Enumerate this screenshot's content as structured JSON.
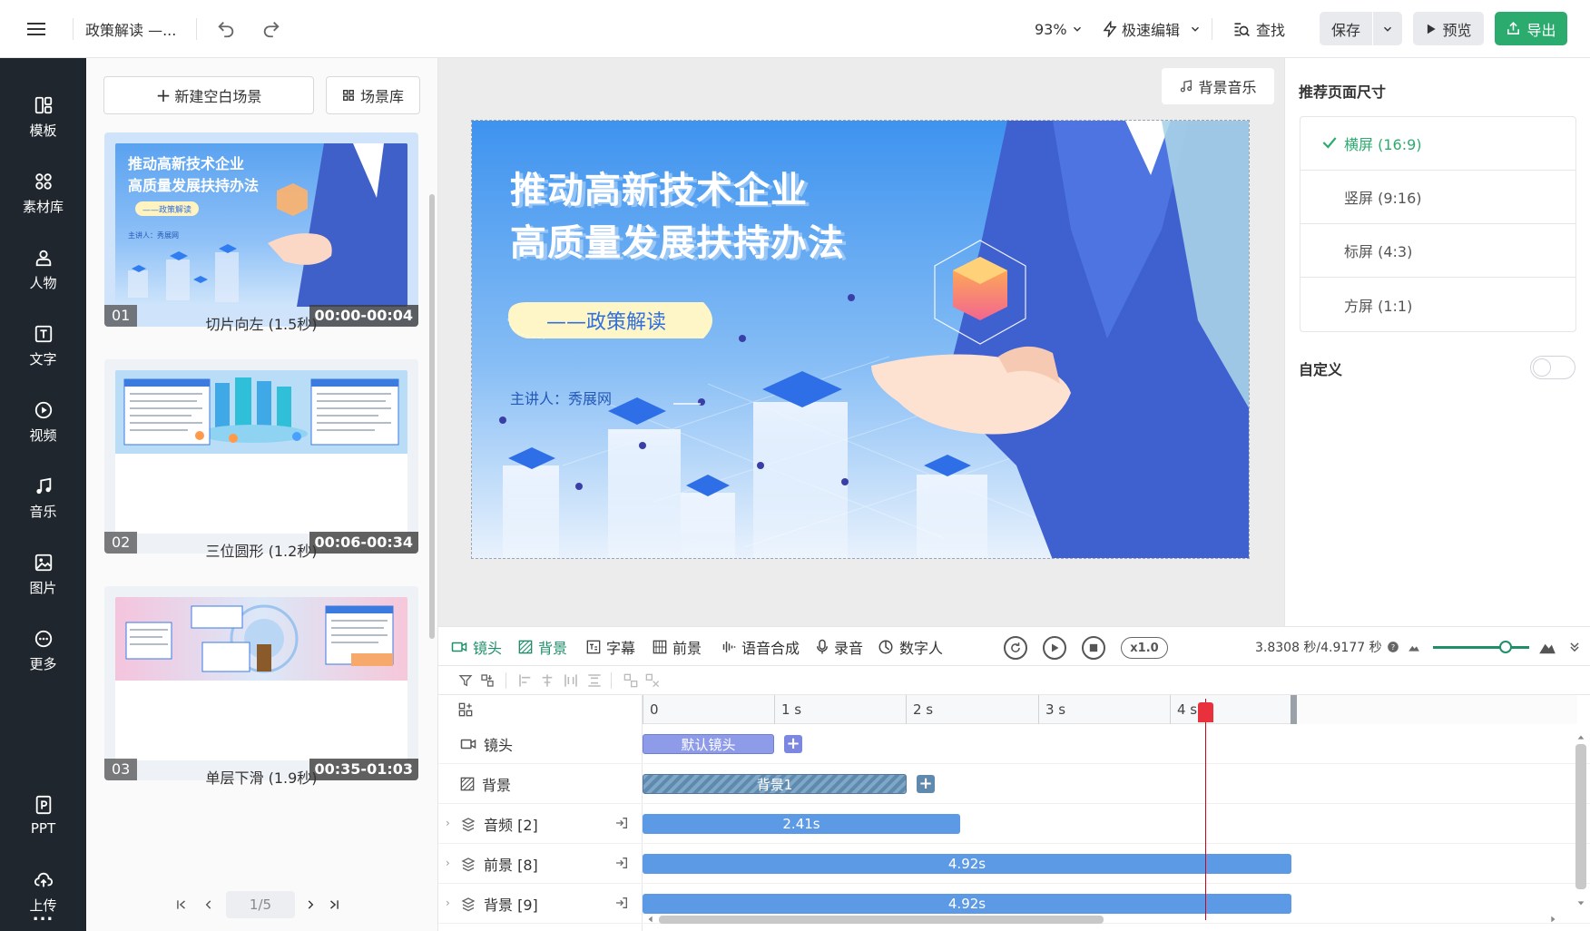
{
  "header": {
    "doc_title": "政策解读 —...",
    "zoom": "93%",
    "quick_edit": "极速编辑",
    "find": "查找",
    "save": "保存",
    "preview": "预览",
    "export": "导出",
    "colors": {
      "export_bg": "#2bab6e",
      "save_bg": "#e8eaed"
    }
  },
  "leftnav": {
    "items": [
      {
        "label": "模板",
        "icon": "template-icon"
      },
      {
        "label": "素材库",
        "icon": "material-icon"
      },
      {
        "label": "人物",
        "icon": "person-icon"
      },
      {
        "label": "文字",
        "icon": "text-icon"
      },
      {
        "label": "视频",
        "icon": "video-icon"
      },
      {
        "label": "音乐",
        "icon": "music-icon"
      },
      {
        "label": "图片",
        "icon": "image-icon"
      },
      {
        "label": "更多",
        "icon": "more-icon"
      },
      {
        "label": "PPT",
        "icon": "ppt-icon"
      },
      {
        "label": "上传",
        "icon": "upload-icon"
      }
    ],
    "overflow": "..."
  },
  "scenes": {
    "new_blank": "新建空白场景",
    "library": "场景库",
    "items": [
      {
        "num": "01",
        "time": "00:00-00:04",
        "caption": "切片向左 (1.5秒)"
      },
      {
        "num": "02",
        "time": "00:06-00:34",
        "caption": "三位圆形 (1.2秒)"
      },
      {
        "num": "03",
        "time": "00:35-01:03",
        "caption": "单层下滑 (1.9秒)"
      }
    ],
    "pager": "1/5"
  },
  "canvas": {
    "bg_music": "背景音乐",
    "slide": {
      "title_line1": "推动高新技术企业",
      "title_line2": "高质量发展扶持办法",
      "subtitle": "——政策解读",
      "speaker": "主讲人：秀展网"
    }
  },
  "right_panel": {
    "title": "推荐页面尺寸",
    "sizes": [
      {
        "label": "横屏 (16:9)",
        "selected": true
      },
      {
        "label": "竖屏 (9:16)",
        "selected": false
      },
      {
        "label": "标屏 (4:3)",
        "selected": false
      },
      {
        "label": "方屏 (1:1)",
        "selected": false
      }
    ],
    "custom": "自定义",
    "custom_on": false
  },
  "timeline": {
    "tabs": [
      "镜头",
      "背景",
      "字幕",
      "前景",
      "语音合成",
      "录音",
      "数字人"
    ],
    "speed": "x1.0",
    "time_display": "3.8308 秒/4.9177 秒",
    "zoom_level": 0.75,
    "ruler": [
      "0",
      "1 s",
      "2 s",
      "3 s",
      "4 s"
    ],
    "rows": [
      {
        "label": "镜头",
        "clip": "默认镜头",
        "expandable": false
      },
      {
        "label": "背景",
        "clip": "背景1",
        "expandable": false
      },
      {
        "label": "音频 [2]",
        "clip": "2.41s",
        "expandable": true
      },
      {
        "label": "前景 [8]",
        "clip": "4.92s",
        "expandable": true
      },
      {
        "label": "背景 [9]",
        "clip": "4.92s",
        "expandable": true
      }
    ]
  }
}
